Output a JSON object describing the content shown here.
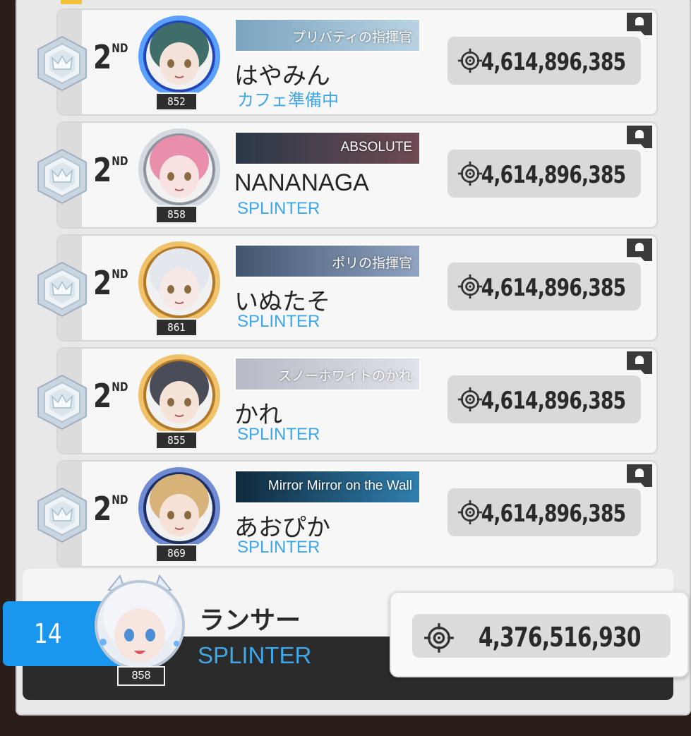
{
  "leaderboard": {
    "rows": [
      {
        "rank": "2",
        "rank_suffix": "ND",
        "level": "852",
        "banner_text": "プリバティの指揮官",
        "banner_colors": [
          "#7ca4c0",
          "#b9d3e2"
        ],
        "name": "はやみん",
        "union": "カフェ準備中",
        "score": "4,614,896,385",
        "frame": "blue",
        "hair": "#3f6e6a",
        "skin": "#f4e3da"
      },
      {
        "rank": "2",
        "rank_suffix": "ND",
        "level": "858",
        "banner_text": "ABSOLUTE",
        "banner_colors": [
          "#2a3848",
          "#6f4a52"
        ],
        "name": "NANANAGA",
        "union": "SPLINTER",
        "score": "4,614,896,385",
        "frame": "silver",
        "hair": "#e98fab",
        "skin": "#f9e2e2"
      },
      {
        "rank": "2",
        "rank_suffix": "ND",
        "level": "861",
        "banner_text": "ポリの指揮官",
        "banner_colors": [
          "#43546e",
          "#8fa4c2"
        ],
        "name": "いぬたそ",
        "union": "SPLINTER",
        "score": "4,614,896,385",
        "frame": "gold",
        "hair": "#e4e7ee",
        "skin": "#f6e9e6"
      },
      {
        "rank": "2",
        "rank_suffix": "ND",
        "level": "855",
        "banner_text": "スノーホワイトのかれ",
        "banner_colors": [
          "#b7b9c4",
          "#dfe2ea"
        ],
        "name": "かれ",
        "union": "SPLINTER",
        "score": "4,614,896,385",
        "frame": "gold",
        "hair": "#4a4c58",
        "skin": "#f5e3d8"
      },
      {
        "rank": "2",
        "rank_suffix": "ND",
        "level": "869",
        "banner_text": "Mirror Mirror on the Wall",
        "banner_colors": [
          "#10293c",
          "#2f7fae"
        ],
        "name": "あおぴか",
        "union": "SPLINTER",
        "score": "4,614,896,385",
        "frame": "navy",
        "hair": "#d7b37a",
        "skin": "#f6e1d6"
      }
    ],
    "self": {
      "rank": "14",
      "level": "858",
      "name": "ランサー",
      "union": "SPLINTER",
      "score": "4,376,516,930"
    }
  },
  "icons": {
    "rank_badge": "crown-hexagon-icon",
    "score": "crosshair-target-icon",
    "chat": "chat-bubble-icon"
  },
  "colors": {
    "union_blue": "#3ea7ea",
    "self_rank_blue": "#1a96ef",
    "top_accent": "#f3c13a"
  }
}
